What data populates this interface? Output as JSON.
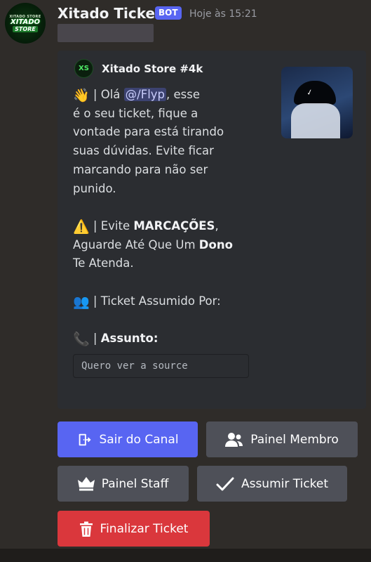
{
  "message": {
    "username": "Xitado Ticket",
    "bot_tag": "BOT",
    "timestamp": "Hoje às 15:21",
    "avatar": {
      "top": "XITADO STORE",
      "main": "XITADO",
      "sub": "STORE"
    }
  },
  "embed": {
    "author": "Xitado Store #4k",
    "author_icon_text": "XS",
    "lines": {
      "greeting_prefix": "| Olá ",
      "mention": "@/Flyp",
      "greeting_suffix": ", esse",
      "line2": "é o seu ticket, fique a",
      "line3": "vontade para está tirando",
      "line4": "suas dúvidas. Evite ficar",
      "line5": "marcando para não ser",
      "line6": "punido.",
      "warn_prefix": "| Evite ",
      "warn_bold": "MARCAÇÕES",
      "warn_suffix": ",",
      "wait_prefix": "Aguarde Até Que Um ",
      "wait_bold": "Dono",
      "wait_line2": "Te Atenda.",
      "assumed": "| Ticket Assumido Por:",
      "subject_sep": "| ",
      "subject_label": "Assunto:"
    },
    "subject_value": "Quero ver a source"
  },
  "buttons": {
    "leave": "Sair do Canal",
    "member_panel": "Painel Membro",
    "staff_panel": "Painel Staff",
    "claim": "Assumir Ticket",
    "close": "Finalizar Ticket"
  },
  "colors": {
    "primary": "#5865f2",
    "secondary": "#4e5058",
    "danger": "#da373c",
    "mention_bg": "#3c4270"
  },
  "icons": {
    "wave": "waving-hand-emoji",
    "warning": "warning-emoji",
    "users": "busts-in-silhouette-emoji",
    "phone": "telephone-receiver-emoji"
  }
}
